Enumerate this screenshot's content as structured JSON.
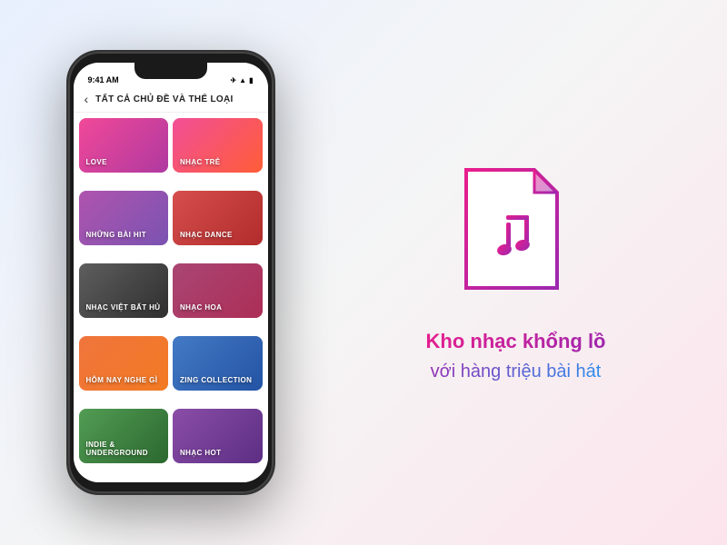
{
  "scene": {
    "background": "light gradient"
  },
  "phone": {
    "status_bar": {
      "time": "9:41 AM",
      "icons": [
        "airplane",
        "wifi",
        "battery"
      ]
    },
    "header": {
      "back_label": "‹",
      "title": "TẤT CẢ CHỦ ĐỀ VÀ THỂ LOẠI"
    },
    "grid_items": [
      {
        "id": "love",
        "label": "LOVE",
        "class": "item-love"
      },
      {
        "id": "nhac-tre",
        "label": "NHẠC TRẺ",
        "class": "item-nhac-tre"
      },
      {
        "id": "nhung-bai-hit",
        "label": "NHỮNG BÀI HIT",
        "class": "item-nhung-bai-hit"
      },
      {
        "id": "nhac-dance",
        "label": "NHẠC DANCE",
        "class": "item-nhac-dance"
      },
      {
        "id": "nhac-viet",
        "label": "NHẠC VIỆT BẤT HỦ",
        "class": "item-nhac-viet"
      },
      {
        "id": "nhac-hoa",
        "label": "NHẠC HOA",
        "class": "item-nhac-hoa"
      },
      {
        "id": "hom-nay",
        "label": "HÔM NAY NGHE GÌ",
        "class": "item-hom-nay"
      },
      {
        "id": "zing",
        "label": "ZING COLLECTION",
        "class": "item-zing"
      },
      {
        "id": "indie",
        "label": "INDIE & UNDERGROUND",
        "class": "item-indie"
      },
      {
        "id": "nhac-hot",
        "label": "NHẠC HOT",
        "class": "item-nhac-hot"
      }
    ]
  },
  "right_panel": {
    "tagline_line1": "Kho nhạc khổng lồ",
    "tagline_line2": "với hàng triệu bài hát"
  }
}
